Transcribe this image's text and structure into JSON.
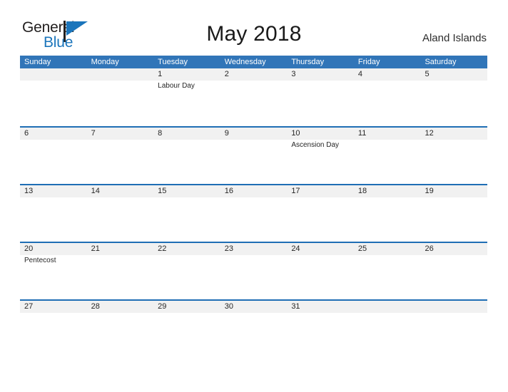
{
  "brand": {
    "name_part1": "General",
    "name_part2": "Blue",
    "triangle_icon": "triangle-icon",
    "colors": {
      "dark": "#221f1f",
      "blue": "#1b75bb"
    }
  },
  "header": {
    "title": "May 2018",
    "locale": "Aland Islands"
  },
  "theme": {
    "header_bar": "#3175b8",
    "row_rule": "#1f6eb5",
    "band": "#f1f1f1",
    "text": "#262626"
  },
  "calendar": {
    "month": "May",
    "year": "2018",
    "weekday_headers": [
      "Sunday",
      "Monday",
      "Tuesday",
      "Wednesday",
      "Thursday",
      "Friday",
      "Saturday"
    ],
    "weeks": [
      [
        {
          "day": "",
          "events": []
        },
        {
          "day": "",
          "events": []
        },
        {
          "day": "1",
          "events": [
            "Labour Day"
          ]
        },
        {
          "day": "2",
          "events": []
        },
        {
          "day": "3",
          "events": []
        },
        {
          "day": "4",
          "events": []
        },
        {
          "day": "5",
          "events": []
        }
      ],
      [
        {
          "day": "6",
          "events": []
        },
        {
          "day": "7",
          "events": []
        },
        {
          "day": "8",
          "events": []
        },
        {
          "day": "9",
          "events": []
        },
        {
          "day": "10",
          "events": [
            "Ascension Day"
          ]
        },
        {
          "day": "11",
          "events": []
        },
        {
          "day": "12",
          "events": []
        }
      ],
      [
        {
          "day": "13",
          "events": []
        },
        {
          "day": "14",
          "events": []
        },
        {
          "day": "15",
          "events": []
        },
        {
          "day": "16",
          "events": []
        },
        {
          "day": "17",
          "events": []
        },
        {
          "day": "18",
          "events": []
        },
        {
          "day": "19",
          "events": []
        }
      ],
      [
        {
          "day": "20",
          "events": [
            "Pentecost"
          ]
        },
        {
          "day": "21",
          "events": []
        },
        {
          "day": "22",
          "events": []
        },
        {
          "day": "23",
          "events": []
        },
        {
          "day": "24",
          "events": []
        },
        {
          "day": "25",
          "events": []
        },
        {
          "day": "26",
          "events": []
        }
      ],
      [
        {
          "day": "27",
          "events": []
        },
        {
          "day": "28",
          "events": []
        },
        {
          "day": "29",
          "events": []
        },
        {
          "day": "30",
          "events": []
        },
        {
          "day": "31",
          "events": []
        },
        {
          "day": "",
          "events": []
        },
        {
          "day": "",
          "events": []
        }
      ]
    ]
  }
}
